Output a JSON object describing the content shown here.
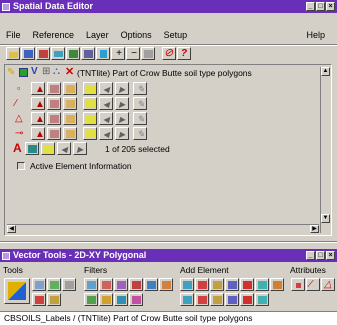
{
  "window": {
    "title": "Spatial Data Editor",
    "accent": "#6a2fb8"
  },
  "menu": [
    "File",
    "Reference",
    "Layer",
    "Options",
    "Setup",
    "Help"
  ],
  "layer": {
    "title": "(TNTlite) Part of Crow Butte soil type polygons"
  },
  "selection": {
    "text": "1 of 205 selected"
  },
  "active_element": {
    "label": "Active Element Information"
  },
  "vector_tools": {
    "title": "Vector Tools - 2D-XY Polygonal",
    "sections": [
      "Tools",
      "Filters",
      "Add Element",
      "Attributes"
    ]
  },
  "status": {
    "text": "CBSOILS_Labels / (TNTlite) Part of Crow Butte soil type polygons"
  },
  "icons": {
    "main_toolbar": [
      "open-icon",
      "save-icon",
      "layer-manager-icon",
      "view-icon",
      "raster-icon",
      "vector-icon",
      "add-layer-icon",
      "remove-layer-icon",
      "properties-icon",
      "zoom-icon",
      "close-layer-icon",
      "help-icon"
    ],
    "layer_controls": [
      "pencil-icon",
      "color-icon",
      "filter-icon",
      "tree-icon",
      "attributes-icon",
      "delete-icon"
    ]
  }
}
